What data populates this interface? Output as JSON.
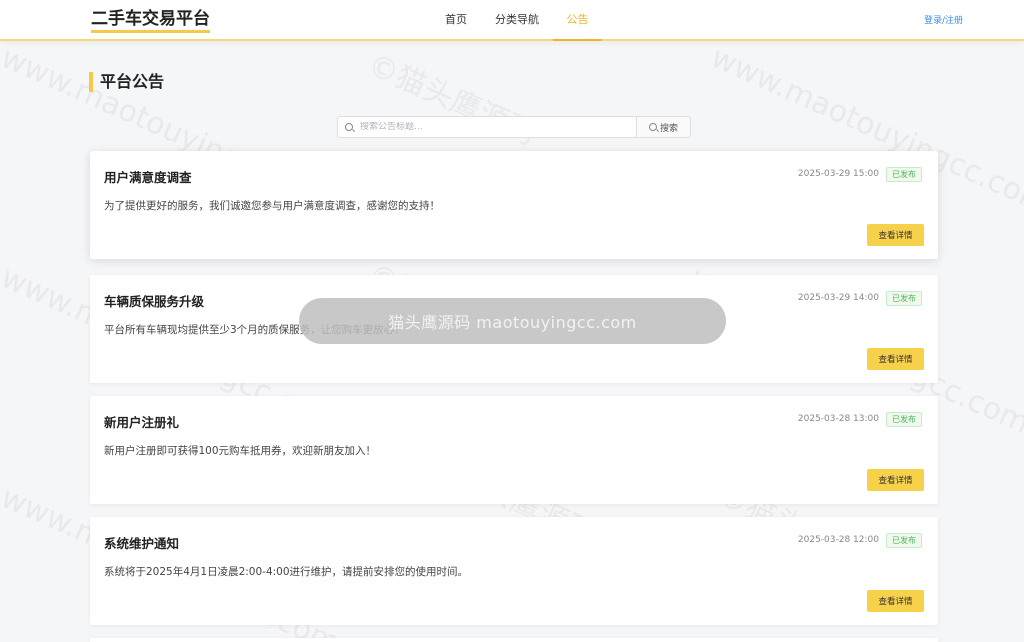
{
  "header": {
    "logo": "二手车交易平台",
    "nav": [
      {
        "label": "首页",
        "active": false
      },
      {
        "label": "分类导航",
        "active": false
      },
      {
        "label": "公告",
        "active": true
      }
    ],
    "login_label": "登录/注册"
  },
  "page": {
    "title": "平台公告"
  },
  "search": {
    "placeholder": "搜索公告标题...",
    "button_label": "搜索"
  },
  "notices": [
    {
      "title": "用户满意度调查",
      "time": "2025-03-29 15:00",
      "status": "已发布",
      "content": "为了提供更好的服务，我们诚邀您参与用户满意度调查，感谢您的支持！",
      "button": "查看详情"
    },
    {
      "title": "车辆质保服务升级",
      "time": "2025-03-29 14:00",
      "status": "已发布",
      "content": "平台所有车辆现均提供至少3个月的质保服务，让您购车更放心！",
      "button": "查看详情"
    },
    {
      "title": "新用户注册礼",
      "time": "2025-03-28 13:00",
      "status": "已发布",
      "content": "新用户注册即可获得100元购车抵用券，欢迎新朋友加入！",
      "button": "查看详情"
    },
    {
      "title": "系统维护通知",
      "time": "2025-03-28 12:00",
      "status": "已发布",
      "content": "系统将于2025年4月1日凌晨2:00-4:00进行维护，请提前安排您的使用时间。",
      "button": "查看详情"
    }
  ],
  "toast": {
    "text": "猫头鹰源码 maotouyingcc.com"
  },
  "watermark": {
    "site": "www.maotouyingcc.com",
    "brand": "©猫头鹰源码"
  },
  "colors": {
    "accent": "#f7c948",
    "nav_active": "#f0b429",
    "badge_green": "#52b464",
    "link_blue": "#3a8ee6"
  }
}
